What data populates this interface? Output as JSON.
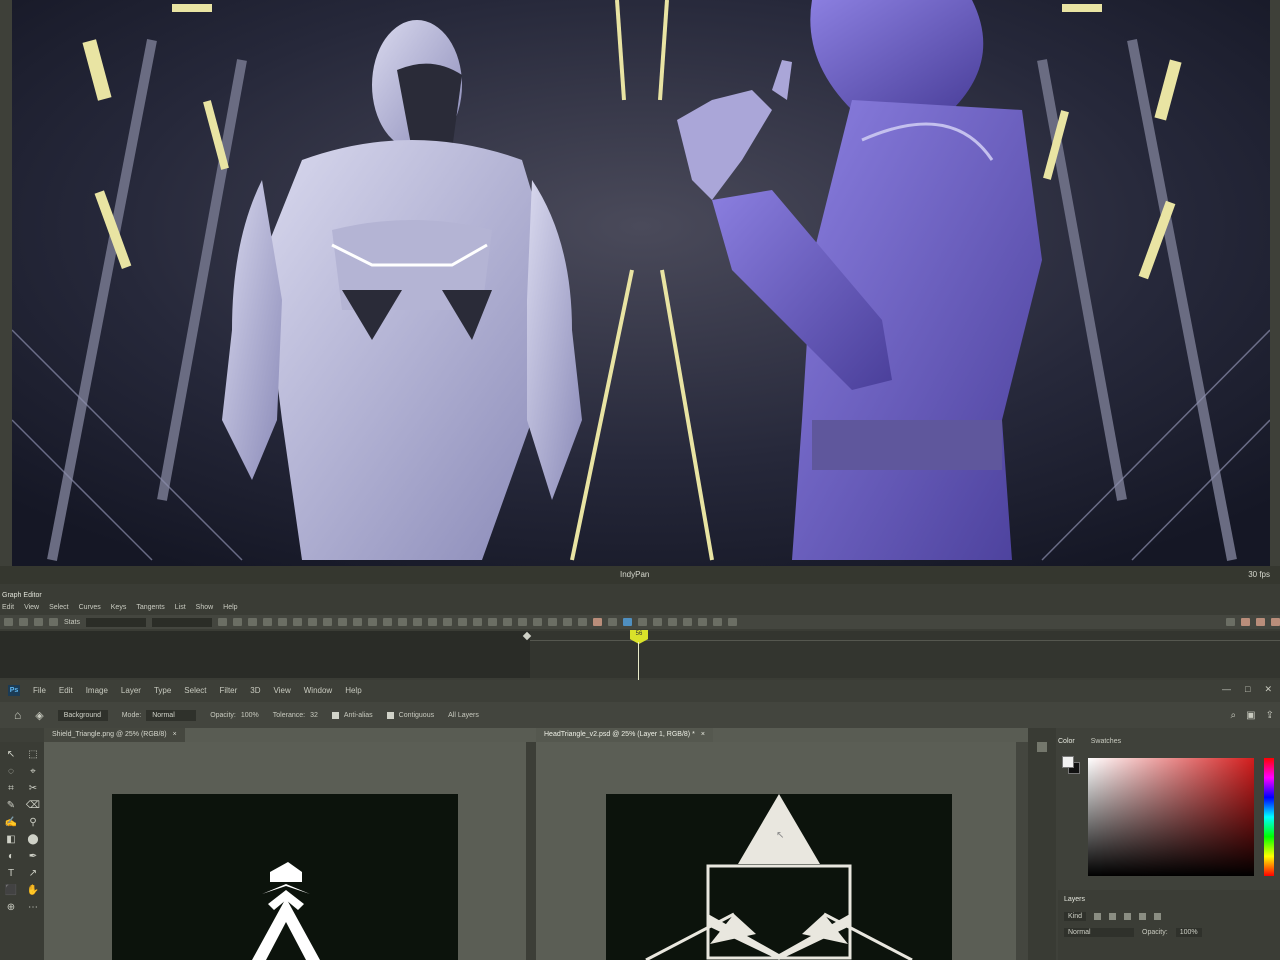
{
  "viewport": {
    "camera_label": "IndyPan",
    "fps_label": "30 fps"
  },
  "graph_editor": {
    "title": "Graph Editor",
    "menu": [
      "Edit",
      "View",
      "Select",
      "Curves",
      "Keys",
      "Tangents",
      "List",
      "Show",
      "Help"
    ],
    "stats_label": "Stats",
    "playhead_label": "56"
  },
  "photoshop": {
    "logo": "Ps",
    "menu": [
      "File",
      "Edit",
      "Image",
      "Layer",
      "Type",
      "Select",
      "Filter",
      "3D",
      "View",
      "Window",
      "Help"
    ],
    "window_controls": [
      "—",
      "□",
      "✕"
    ],
    "options": {
      "sample_label": "Background",
      "mode_label": "Mode:",
      "mode_value": "Normal",
      "opacity_label": "Opacity:",
      "opacity_value": "100%",
      "tolerance_label": "Tolerance:",
      "tolerance_value": "32",
      "antialias_label": "Anti-alias",
      "contiguous_label": "Contiguous",
      "all_layers_label": "All Layers"
    },
    "doc_tabs": [
      {
        "title": "Shield_Triangle.png @ 25% (RGB/8)"
      },
      {
        "title": "HeadTriangle_v2.psd @ 25% (Layer 1, RGB/8) *"
      }
    ],
    "panels": {
      "color_tabs": [
        "Color",
        "Swatches"
      ],
      "layers_tab": "Layers",
      "kind_label": "Kind",
      "blend_mode": "Normal",
      "opacity_label": "Opacity:",
      "opacity_value": "100%"
    },
    "tools": [
      "↖",
      "⬚",
      "◌",
      "⌖",
      "⌗",
      "✂",
      "✎",
      "⌫",
      "✍",
      "⚲",
      "◧",
      "⬤",
      "◐",
      "✒",
      "T",
      "↗",
      "⬛",
      "✋",
      "⊕",
      "⋯"
    ]
  },
  "colors": {
    "playhead": "#d9e22a",
    "picker_hue": "#d31d1d",
    "canvas": "#0c130c"
  }
}
